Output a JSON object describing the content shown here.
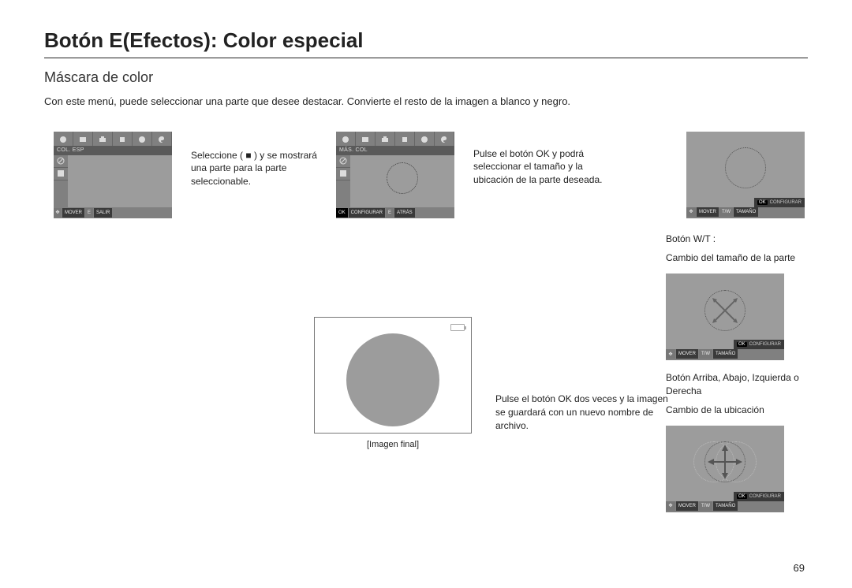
{
  "title": "Botón E(Efectos): Color especial",
  "subtitle": "Máscara de color",
  "intro": "Con este menú, puede seleccionar una parte que desee destacar. Convierte el resto de la imagen a blanco y negro.",
  "shot1": {
    "title": "COL. ESP",
    "footer": {
      "a": "MOVER",
      "b": "E",
      "c": "SALIR"
    }
  },
  "desc1": "Seleccione ( ■ ) y se mostrará una parte para la parte seleccionable.",
  "shot2": {
    "title": "MÁS. COL",
    "footer": {
      "a": "OK",
      "b": "CONFIGURAR",
      "c": "E",
      "d": "ATRÁS"
    }
  },
  "desc2": "Pulse el botón OK y podrá seleccionar el tamaño y la ubicación de la parte deseada.",
  "shotB": {
    "ok": "OK",
    "ok_lbl": "CONFIGURAR",
    "f1": "MOVER",
    "f2": "T/W",
    "f3": "TAMAÑO"
  },
  "right": {
    "wt_title": "Botón W/T :",
    "wt_desc": "Cambio del tamaño de la parte",
    "dir_title": "Botón Arriba, Abajo, Izquierda o Derecha",
    "dir_desc": "Cambio de la ubicación"
  },
  "final": {
    "desc": "Pulse el botón OK dos veces y la imagen se guardará con un nuevo nombre de archivo.",
    "caption": "[Imagen final]"
  },
  "pagenum": "69"
}
